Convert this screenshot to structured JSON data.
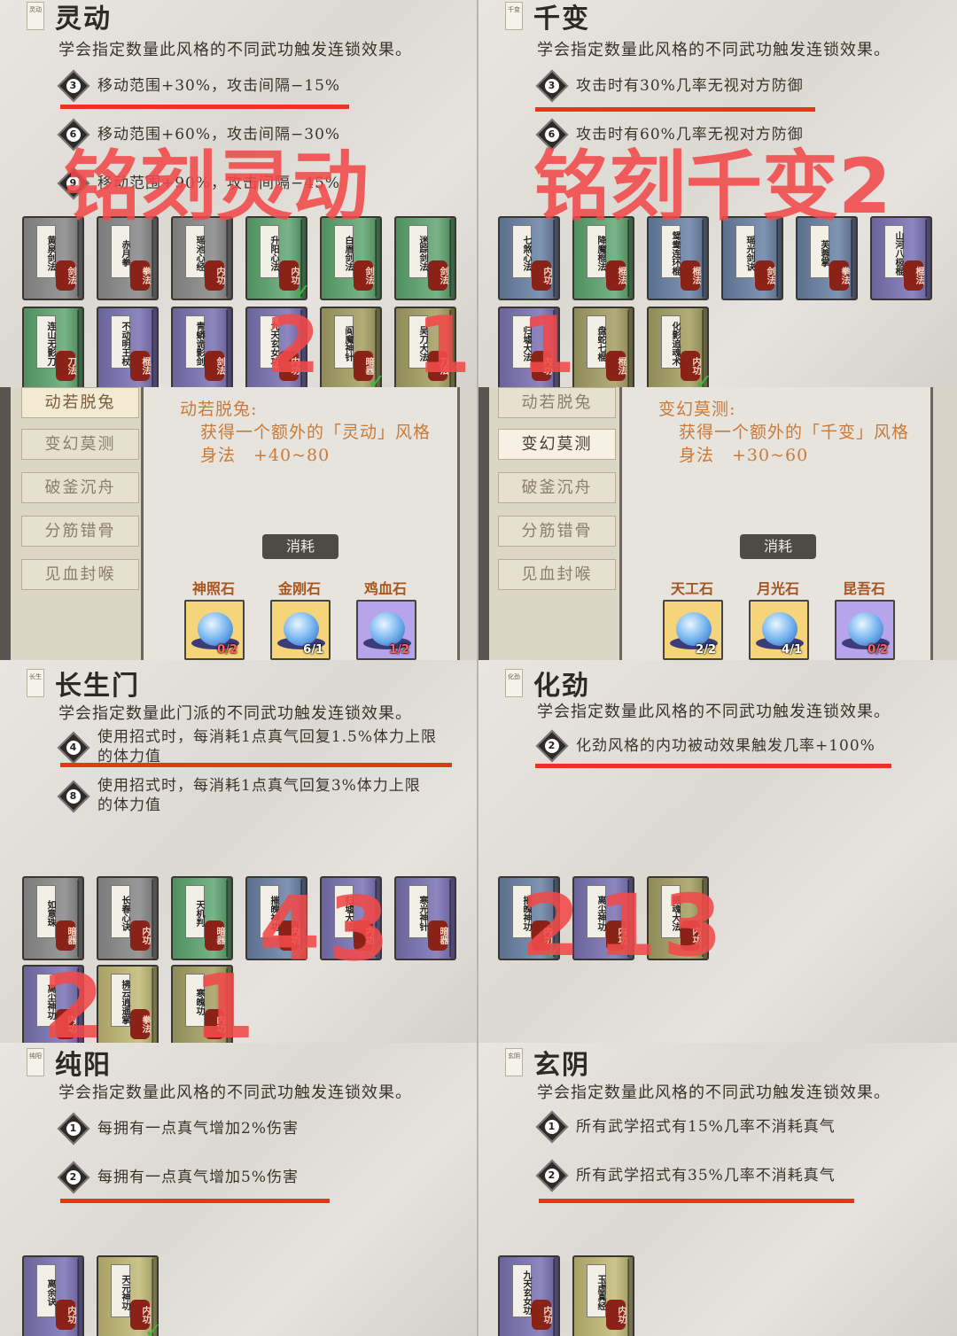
{
  "panels": {
    "lingdong": {
      "tag": "灵动",
      "title": "灵动",
      "desc": "学会指定数量此风格的不同武功触发连锁效果。",
      "effects": [
        {
          "num": "3",
          "text": "移动范围+30%，攻击间隔−15%"
        },
        {
          "num": "6",
          "text": "移动范围+60%，攻击间隔−30%"
        },
        {
          "num": "9",
          "text": "移动范围+90%，攻击间隔−45%"
        }
      ],
      "overlay": "铭刻灵动",
      "marks": [
        "2",
        "1"
      ],
      "books": [
        {
          "name": "黄泉剑法",
          "stamp": "剑法",
          "color": "gray",
          "check": false
        },
        {
          "name": "赤月拳",
          "stamp": "拳法",
          "color": "gray",
          "check": false
        },
        {
          "name": "瑶池心经",
          "stamp": "内功",
          "color": "gray",
          "check": false
        },
        {
          "name": "升阳心法",
          "stamp": "内功",
          "color": "green",
          "check": true
        },
        {
          "name": "白眉剑法",
          "stamp": "剑法",
          "color": "green",
          "check": false
        },
        {
          "name": "迷踪剑法",
          "stamp": "剑法",
          "color": "green",
          "check": false
        },
        {
          "name": "连山无影刀",
          "stamp": "刀法",
          "color": "green",
          "check": false
        },
        {
          "name": "不动明王杖",
          "stamp": "棍法",
          "color": "purple",
          "check": false
        },
        {
          "name": "青蟒诡影剑",
          "stamp": "剑法",
          "color": "purple",
          "check": false
        },
        {
          "name": "九天玄女功",
          "stamp": "内功",
          "color": "purple",
          "check": false
        },
        {
          "name": "阎魔神针",
          "stamp": "暗器",
          "color": "olive",
          "check": true
        },
        {
          "name": "吴刀大法",
          "stamp": "刀法",
          "color": "olive",
          "check": false
        }
      ]
    },
    "qianbian": {
      "tag": "千变",
      "title": "千变",
      "desc": "学会指定数量此风格的不同武功触发连锁效果。",
      "effects": [
        {
          "num": "3",
          "text": "攻击时有30%几率无视对方防御"
        },
        {
          "num": "6",
          "text": "攻击时有60%几率无视对方防御"
        }
      ],
      "overlay": "铭刻千变2",
      "marks": [
        "1"
      ],
      "books": [
        {
          "name": "七煞心法",
          "stamp": "内功",
          "color": "blue",
          "check": false
        },
        {
          "name": "降魔棍法",
          "stamp": "棍法",
          "color": "green",
          "check": false
        },
        {
          "name": "鸳鸯连环棍",
          "stamp": "棍法",
          "color": "blue",
          "check": false
        },
        {
          "name": "瑶光剑诀",
          "stamp": "剑法",
          "color": "blue",
          "check": false
        },
        {
          "name": "芙蓉掌",
          "stamp": "拳法",
          "color": "blue",
          "check": false
        },
        {
          "name": "山河八极棍",
          "stamp": "棍法",
          "color": "purple",
          "check": false
        },
        {
          "name": "归墟大法",
          "stamp": "内功",
          "color": "purple",
          "check": false
        },
        {
          "name": "盘蛇七棍",
          "stamp": "棍法",
          "color": "olive",
          "check": false
        },
        {
          "name": "化影追魂术",
          "stamp": "内功",
          "color": "olive",
          "check": true
        }
      ]
    },
    "changsheng": {
      "tag": "长生",
      "title": "长生门",
      "desc": "学会指定数量此门派的不同武功触发连锁效果。",
      "effects": [
        {
          "num": "4",
          "text": "使用招式时，每消耗1点真气回复1.5%体力上限",
          "text2": "的体力值"
        },
        {
          "num": "8",
          "text": "使用招式时，每消耗1点真气回复3%体力上限",
          "text2": "的体力值"
        }
      ],
      "marks": [
        "4",
        "3",
        "2",
        "1"
      ],
      "books": [
        {
          "name": "如意珠",
          "stamp": "暗器",
          "color": "gray",
          "check": false
        },
        {
          "name": "长春心诀",
          "stamp": "内功",
          "color": "gray",
          "check": false
        },
        {
          "name": "天机判",
          "stamp": "暗器",
          "color": "green",
          "check": false
        },
        {
          "name": "摧魄神功",
          "stamp": "内功",
          "color": "blue",
          "check": true
        },
        {
          "name": "归墟大法",
          "stamp": "内功",
          "color": "purple",
          "check": true
        },
        {
          "name": "寒光神针",
          "stamp": "暗器",
          "color": "purple",
          "check": false
        },
        {
          "name": "离尘神功",
          "stamp": "内功",
          "color": "purple",
          "check": false
        },
        {
          "name": "拂云逍遥掌",
          "stamp": "拳法",
          "color": "yellow",
          "check": false
        },
        {
          "name": "寒魄功",
          "stamp": "内功",
          "color": "olive",
          "check": false
        }
      ]
    },
    "huajin": {
      "tag": "化劲",
      "title": "化劲",
      "desc": "学会指定数量此风格的不同武功触发连锁效果。",
      "effects": [
        {
          "num": "2",
          "text": "化劲风格的内功被动效果触发几率+100%"
        }
      ],
      "marks": [
        "2",
        "1",
        "3"
      ],
      "books": [
        {
          "name": "摧魄神功",
          "stamp": "内功",
          "color": "blue",
          "check": true
        },
        {
          "name": "离尘神功",
          "stamp": "内功",
          "color": "purple",
          "check": false
        },
        {
          "name": "摄魂大法",
          "stamp": "内功",
          "color": "olive",
          "check": true
        }
      ]
    },
    "chunyang": {
      "tag": "纯阳",
      "title": "纯阳",
      "desc": "学会指定数量此风格的不同武功触发连锁效果。",
      "effects": [
        {
          "num": "1",
          "text": "每拥有一点真气增加2%伤害"
        },
        {
          "num": "2",
          "text": "每拥有一点真气增加5%伤害"
        }
      ],
      "books": [
        {
          "name": "离余诀",
          "stamp": "内功",
          "color": "purple",
          "check": false
        },
        {
          "name": "天元神功",
          "stamp": "内功",
          "color": "yellow",
          "check": true
        }
      ]
    },
    "xuanyin": {
      "tag": "玄阴",
      "title": "玄阴",
      "desc": "学会指定数量此风格的不同武功触发连锁效果。",
      "effects": [
        {
          "num": "1",
          "text": "所有武学招式有15%几率不消耗真气"
        },
        {
          "num": "2",
          "text": "所有武学招式有35%几率不消耗真气"
        }
      ],
      "books": [
        {
          "name": "九天玄女功",
          "stamp": "内功",
          "color": "purple",
          "check": false
        },
        {
          "name": "玉虚真经",
          "stamp": "内功",
          "color": "yellow",
          "check": false
        }
      ]
    }
  },
  "engrave_left": {
    "tabs": [
      "动若脱兔",
      "变幻莫测",
      "破釜沉舟",
      "分筋错骨",
      "见血封喉"
    ],
    "info_title": "动若脱兔:",
    "info_line1": "获得一个额外的「灵动」风格",
    "info_line2": "身法　+40~80",
    "cost_label": "消耗",
    "gems": [
      {
        "name": "神照石",
        "count": "0/2",
        "bad": true,
        "color": "yellow"
      },
      {
        "name": "金刚石",
        "count": "6/1",
        "bad": false,
        "color": "yellow"
      },
      {
        "name": "鸡血石",
        "count": "1/2",
        "bad": true,
        "color": "purple"
      }
    ]
  },
  "engrave_right": {
    "tabs": [
      "动若脱兔",
      "变幻莫测",
      "破釜沉舟",
      "分筋错骨",
      "见血封喉"
    ],
    "info_title": "变幻莫测:",
    "info_line1": "获得一个额外的「千变」风格",
    "info_line2": "身法　+30~60",
    "cost_label": "消耗",
    "gems": [
      {
        "name": "天工石",
        "count": "2/2",
        "bad": false,
        "color": "yellow"
      },
      {
        "name": "月光石",
        "count": "4/1",
        "bad": false,
        "color": "yellow"
      },
      {
        "name": "昆吾石",
        "count": "0/2",
        "bad": true,
        "color": "purple"
      }
    ]
  }
}
